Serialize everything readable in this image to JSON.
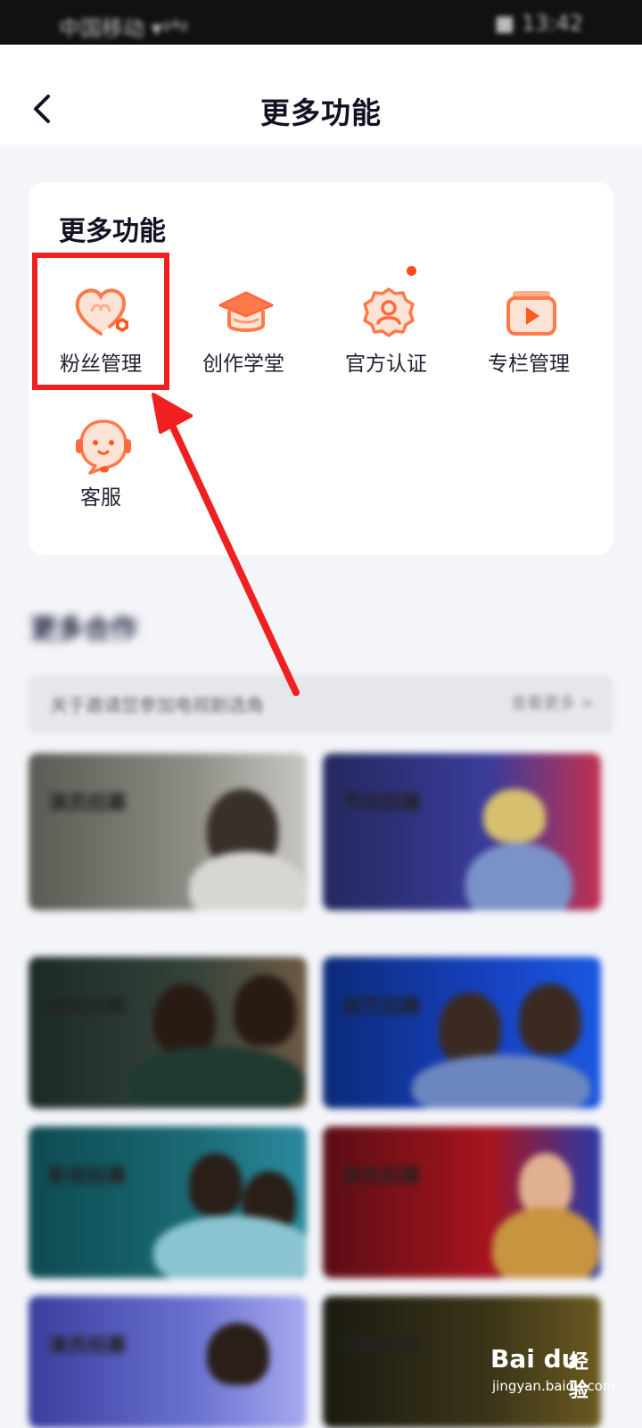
{
  "status_bar": {
    "carrier": "中国移动 ▾ᵍ⁴ᵍ",
    "time": "■ 13:42"
  },
  "header": {
    "title": "更多功能",
    "back_icon": "chevron-left-icon"
  },
  "card": {
    "title": "更多功能",
    "items": [
      {
        "label": "粉丝管理",
        "icon": "heart-gear-icon",
        "highlighted": true
      },
      {
        "label": "创作学堂",
        "icon": "graduation-cap-icon"
      },
      {
        "label": "官方认证",
        "icon": "verified-badge-icon",
        "has_dot": true
      },
      {
        "label": "专栏管理",
        "icon": "play-album-icon"
      },
      {
        "label": "客服",
        "icon": "customer-service-icon"
      }
    ]
  },
  "section": {
    "title": "更多合作"
  },
  "search": {
    "placeholder": "关于邀请您参加电视剧选角",
    "right_text": "查看更多 >"
  },
  "thumbnails": [
    {
      "label": "演员招募"
    },
    {
      "label": "节目招募"
    },
    {
      "label": "剧组招募"
    },
    {
      "label": "综艺招募"
    },
    {
      "label": "影视招募"
    },
    {
      "label": "角色招募"
    },
    {
      "label": "演员招募"
    },
    {
      "label": "剧组招募"
    }
  ],
  "watermark": {
    "brand": "Bai du",
    "cn": "经验",
    "url": "jingyan.baidu.com"
  },
  "colors": {
    "accent_orange": "#ff6a3d",
    "highlight_red": "#f02020",
    "badge": "#ff4a1c"
  }
}
